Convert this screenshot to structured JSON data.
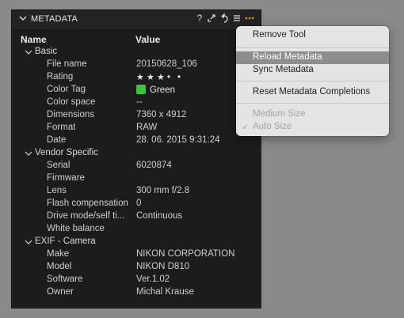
{
  "panel": {
    "title": "METADATA",
    "icons": [
      "help-icon",
      "detach-icon",
      "reset-icon",
      "list-icon",
      "more-icon"
    ],
    "help_glyph": "?",
    "columns": {
      "name": "Name",
      "value": "Value"
    },
    "groups": [
      {
        "name": "Basic",
        "rows": [
          {
            "label": "File name",
            "value": "20150628_106"
          },
          {
            "label": "Rating",
            "value": "",
            "stars": 3,
            "max": 5
          },
          {
            "label": "Color Tag",
            "value": "Green",
            "color": "#3cc43c"
          },
          {
            "label": "Color space",
            "value": "--"
          },
          {
            "label": "Dimensions",
            "value": "7360 x 4912"
          },
          {
            "label": "Format",
            "value": "RAW"
          },
          {
            "label": "Date",
            "value": "28. 06. 2015 9:31:24"
          }
        ]
      },
      {
        "name": "Vendor Specific",
        "rows": [
          {
            "label": "Serial",
            "value": "6020874"
          },
          {
            "label": "Firmware",
            "value": ""
          },
          {
            "label": "Lens",
            "value": "300 mm f/2.8"
          },
          {
            "label": "Flash compensation",
            "value": "0"
          },
          {
            "label": "Drive mode/self ti...",
            "value": "Continuous"
          },
          {
            "label": "White balance",
            "value": ""
          }
        ]
      },
      {
        "name": "EXIF - Camera",
        "rows": [
          {
            "label": "Make",
            "value": "NIKON CORPORATION"
          },
          {
            "label": "Model",
            "value": "NIKON D810"
          },
          {
            "label": "Software",
            "value": "Ver.1.02"
          },
          {
            "label": "Owner",
            "value": "Michal Krause"
          }
        ]
      }
    ]
  },
  "menu": {
    "items": [
      {
        "label": "Remove Tool",
        "state": "normal"
      },
      {
        "label": "Reload Metadata",
        "state": "highlighted"
      },
      {
        "label": "Sync Metadata",
        "state": "normal"
      },
      {
        "label": "Reset Metadata Completions",
        "state": "normal"
      },
      {
        "label": "Medium Size",
        "state": "disabled"
      },
      {
        "label": "Auto Size",
        "state": "disabled",
        "checked": true
      }
    ],
    "check_glyph": "✓"
  },
  "colors": {
    "background": "#8a8a8a",
    "panel": "#1c1c1c",
    "menu": "#e4e4e4",
    "highlight": "#8d8d8d",
    "color_tag": "#3cc43c"
  }
}
